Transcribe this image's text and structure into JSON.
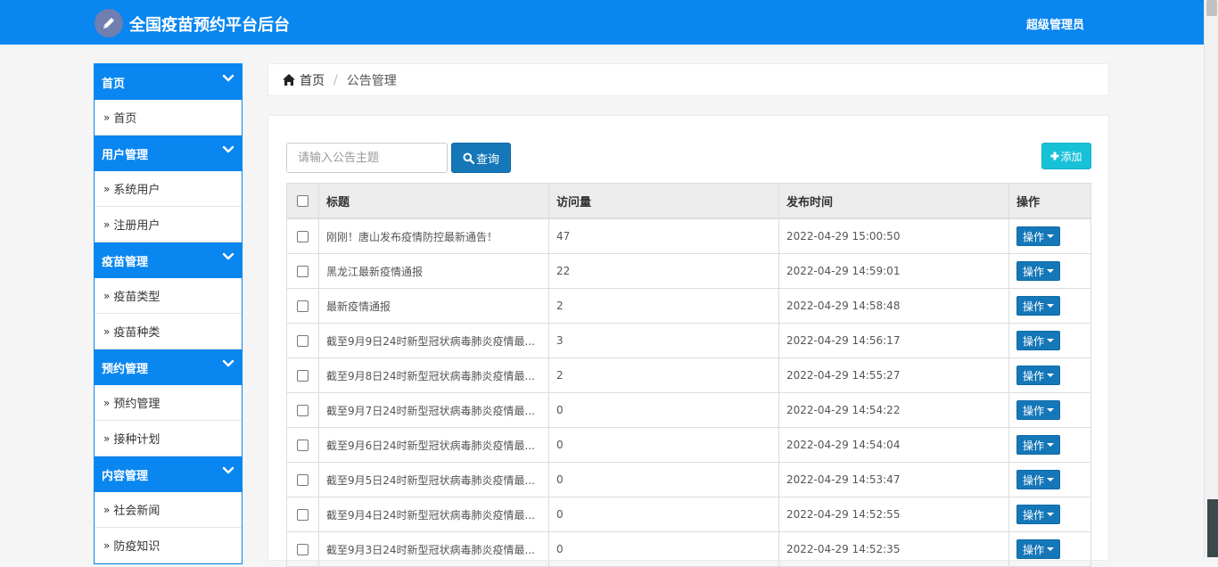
{
  "app": {
    "title": "全国疫苗预约平台后台",
    "user": "超级管理员"
  },
  "colors": {
    "brand": "#0a86f0",
    "primary_button": "#1577b8",
    "add_button": "#17c1d8"
  },
  "sidebar": {
    "groups": [
      {
        "title": "首页",
        "items": [
          "首页"
        ]
      },
      {
        "title": "用户管理",
        "items": [
          "系统用户",
          "注册用户"
        ]
      },
      {
        "title": "疫苗管理",
        "items": [
          "疫苗类型",
          "疫苗种类"
        ]
      },
      {
        "title": "预约管理",
        "items": [
          "预约管理",
          "接种计划"
        ]
      },
      {
        "title": "内容管理",
        "items": [
          "社会新闻",
          "防疫知识"
        ]
      }
    ],
    "item_prefix": "»"
  },
  "breadcrumb": {
    "home": "首页",
    "current": "公告管理"
  },
  "toolbar": {
    "search_placeholder": "请输入公告主题",
    "search_label": "查询",
    "add_label": "添加"
  },
  "table": {
    "columns": [
      "标题",
      "访问量",
      "发布时间",
      "操作"
    ],
    "action_label": "操作",
    "rows": [
      {
        "title": "刚刚！唐山发布疫情防控最新通告！",
        "views": "47",
        "time": "2022-04-29 15:00:50"
      },
      {
        "title": "黑龙江最新疫情通报",
        "views": "22",
        "time": "2022-04-29 14:59:01"
      },
      {
        "title": "最新疫情通报",
        "views": "2",
        "time": "2022-04-29 14:58:48"
      },
      {
        "title": "截至9月9日24时新型冠状病毒肺炎疫情最...",
        "views": "3",
        "time": "2022-04-29 14:56:17"
      },
      {
        "title": "截至9月8日24时新型冠状病毒肺炎疫情最...",
        "views": "2",
        "time": "2022-04-29 14:55:27"
      },
      {
        "title": "截至9月7日24时新型冠状病毒肺炎疫情最...",
        "views": "0",
        "time": "2022-04-29 14:54:22"
      },
      {
        "title": "截至9月6日24时新型冠状病毒肺炎疫情最...",
        "views": "0",
        "time": "2022-04-29 14:54:04"
      },
      {
        "title": "截至9月5日24时新型冠状病毒肺炎疫情最...",
        "views": "0",
        "time": "2022-04-29 14:53:47"
      },
      {
        "title": "截至9月4日24时新型冠状病毒肺炎疫情最...",
        "views": "0",
        "time": "2022-04-29 14:52:55"
      },
      {
        "title": "截至9月3日24时新型冠状病毒肺炎疫情最...",
        "views": "0",
        "time": "2022-04-29 14:52:35"
      }
    ]
  }
}
